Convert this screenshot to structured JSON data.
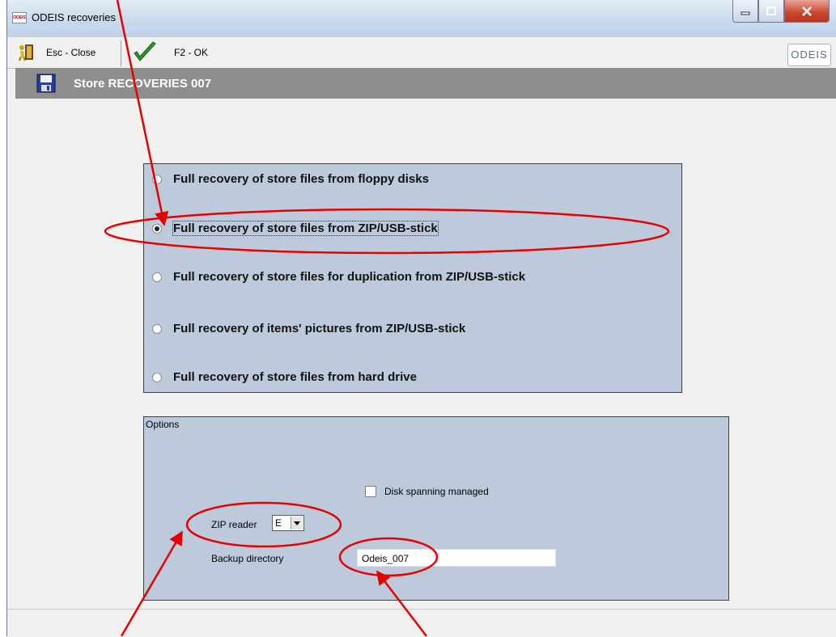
{
  "window": {
    "title": "ODEIS recoveries",
    "app_icon": "odeis-app-icon"
  },
  "toolbar": {
    "close_label": "Esc - Close",
    "ok_label": "F2 - OK",
    "logo_text": "ODEIS"
  },
  "header": {
    "title": "Store RECOVERIES 007"
  },
  "recovery_options": [
    {
      "label": "Full recovery of store files from floppy disks",
      "selected": false
    },
    {
      "label": "Full recovery of store files from ZIP/USB-stick",
      "selected": true
    },
    {
      "label": "Full recovery of store files for duplication from ZIP/USB-stick",
      "selected": false
    },
    {
      "label": "Full recovery of items' pictures from ZIP/USB-stick",
      "selected": false
    },
    {
      "label": "Full recovery of store files from hard drive",
      "selected": false
    }
  ],
  "options": {
    "title": "Options",
    "disk_spanning_label": "Disk spanning managed",
    "disk_spanning_checked": false,
    "zip_reader_label": "ZIP reader",
    "zip_reader_value": "E",
    "backup_dir_label": "Backup directory",
    "backup_dir_value": "Odeis_007"
  },
  "colors": {
    "annotation": "#e60000",
    "panel": "#bdcadc",
    "header": "#8e8e8e"
  }
}
